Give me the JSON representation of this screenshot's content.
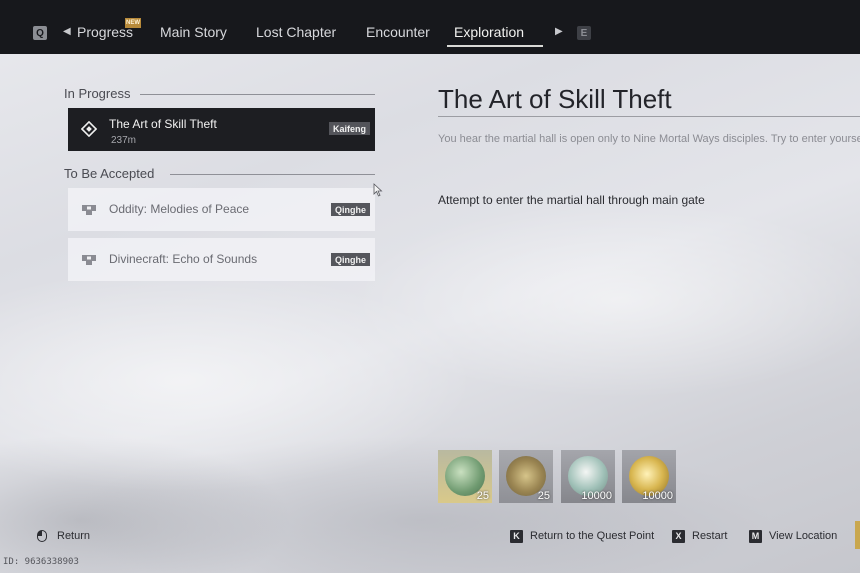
{
  "nav": {
    "left_key": "Q",
    "right_key": "E",
    "new_badge": "NEW",
    "tabs": [
      {
        "label": "Progress"
      },
      {
        "label": "Main Story"
      },
      {
        "label": "Lost Chapter"
      },
      {
        "label": "Encounter"
      },
      {
        "label": "Exploration"
      }
    ],
    "active_tab": "Exploration"
  },
  "in_progress": {
    "heading": "In Progress",
    "quests": [
      {
        "title": "The Art of Skill Theft",
        "distance": "237m",
        "location": "Kaifeng"
      }
    ]
  },
  "to_be_accepted": {
    "heading": "To Be Accepted",
    "quests": [
      {
        "title": "Oddity: Melodies of Peace",
        "location": "Qinghe"
      },
      {
        "title": "Divinecraft: Echo of Sounds",
        "location": "Qinghe"
      }
    ]
  },
  "detail": {
    "title": "The Art of Skill Theft",
    "description": "You hear the martial hall is open only to Nine Mortal Ways disciples. Try to enter yourself.",
    "objective": "Attempt to enter the martial hall through main gate"
  },
  "rewards": [
    {
      "icon": "jade-item-icon",
      "count": "25"
    },
    {
      "icon": "coin-token-icon",
      "count": "25"
    },
    {
      "icon": "swirl-currency-icon",
      "count": "10000"
    },
    {
      "icon": "copper-coins-icon",
      "count": "10000"
    }
  ],
  "footer": {
    "return_label": "Return",
    "hints": [
      {
        "key": "K",
        "label": "Return to the Quest Point"
      },
      {
        "key": "X",
        "label": "Restart"
      },
      {
        "key": "M",
        "label": "View Location"
      }
    ],
    "uid": "ID: 9636338903"
  },
  "colors": {
    "topbar": "#17181c",
    "selected_card": "#1d1e22",
    "accent_gold": "#c9a74e"
  }
}
